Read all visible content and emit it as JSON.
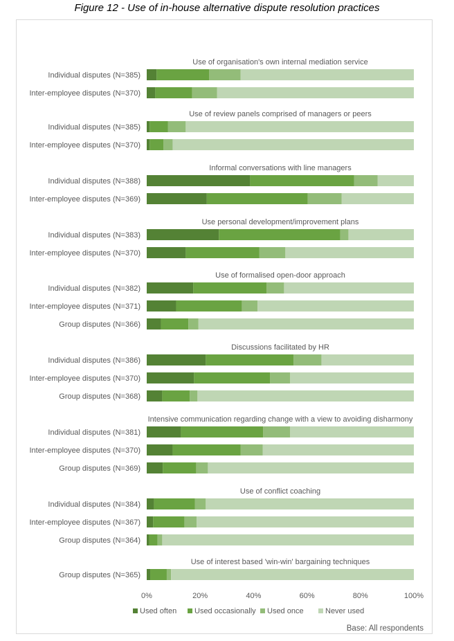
{
  "figure_title": "Figure 12 - Use of in-house alternative dispute resolution practices",
  "base_note": "Base: All respondents",
  "chart_data": {
    "type": "bar",
    "orientation": "horizontal",
    "stacked": "percent",
    "title": "Figure 12 - Use of in-house alternative dispute resolution practices",
    "xlabel": "",
    "ylabel": "",
    "xlim": [
      0,
      100
    ],
    "x_ticks": [
      "0%",
      "20%",
      "40%",
      "60%",
      "80%",
      "100%"
    ],
    "grid": false,
    "legend_position": "bottom",
    "legend": [
      {
        "name": "Used often",
        "color": "#548235"
      },
      {
        "name": "Used occasionally",
        "color": "#6aa342"
      },
      {
        "name": "Used once",
        "color": "#93bc79"
      },
      {
        "name": "Never used",
        "color": "#bfd6b4"
      }
    ],
    "groups": [
      {
        "title": "Use of organisation's own internal mediation service",
        "rows": [
          {
            "label": "Individual disputes (N=385)",
            "values": [
              3.7,
              19.7,
              11.7,
              64.9
            ]
          },
          {
            "label": "Inter-employee disputes (N=370)",
            "values": [
              3.2,
              13.8,
              9.3,
              73.7
            ]
          }
        ]
      },
      {
        "title": "Use of review panels comprised of managers or peers",
        "rows": [
          {
            "label": "Individual disputes (N=385)",
            "values": [
              1.1,
              6.8,
              6.7,
              85.4
            ]
          },
          {
            "label": "Inter-employee disputes (N=370)",
            "values": [
              1.1,
              5.2,
              3.4,
              90.3
            ]
          }
        ]
      },
      {
        "title": "Informal conversations with line managers",
        "rows": [
          {
            "label": "Individual disputes (N=388)",
            "values": [
              38.7,
              38.9,
              8.8,
              13.6
            ]
          },
          {
            "label": "Inter-employee disputes (N=369)",
            "values": [
              22.5,
              37.8,
              12.7,
              27.0
            ]
          }
        ]
      },
      {
        "title": "Use personal development/improvement plans",
        "rows": [
          {
            "label": "Individual disputes (N=383)",
            "values": [
              27.0,
              45.4,
              3.1,
              24.5
            ]
          },
          {
            "label": "Inter-employee disputes (N=370)",
            "values": [
              14.6,
              27.5,
              9.8,
              48.1
            ]
          }
        ]
      },
      {
        "title": "Use of formalised open-door approach",
        "rows": [
          {
            "label": "Individual disputes (N=382)",
            "values": [
              17.4,
              27.5,
              6.5,
              48.6
            ]
          },
          {
            "label": "Inter-employee disputes (N=371)",
            "values": [
              11.0,
              24.6,
              5.9,
              58.5
            ]
          },
          {
            "label": "Group disputes (N=366)",
            "values": [
              5.3,
              10.3,
              3.7,
              80.7
            ]
          }
        ]
      },
      {
        "title": "Discussions facilitated by HR",
        "rows": [
          {
            "label": "Individual disputes (N=386)",
            "values": [
              22.1,
              32.9,
              10.4,
              34.6
            ]
          },
          {
            "label": "Inter-employee disputes (N=370)",
            "values": [
              17.7,
              28.5,
              7.5,
              46.3
            ]
          },
          {
            "label": "Group disputes (N=368)",
            "values": [
              5.8,
              10.3,
              2.9,
              81.0
            ]
          }
        ]
      },
      {
        "title": "Intensive communication regarding change with a view to avoiding disharmony",
        "rows": [
          {
            "label": "Individual disputes (N=381)",
            "values": [
              12.8,
              30.8,
              10.1,
              46.3
            ]
          },
          {
            "label": "Inter-employee disputes (N=370)",
            "values": [
              9.7,
              25.4,
              8.3,
              56.6
            ]
          },
          {
            "label": "Group disputes (N=369)",
            "values": [
              6.0,
              12.5,
              4.4,
              77.1
            ]
          }
        ]
      },
      {
        "title": "Use of conflict coaching",
        "rows": [
          {
            "label": "Individual disputes (N=384)",
            "values": [
              2.7,
              15.3,
              4.1,
              77.9
            ]
          },
          {
            "label": "Inter-employee disputes (N=367)",
            "values": [
              2.4,
              11.7,
              4.6,
              81.3
            ]
          },
          {
            "label": "Group disputes (N=364)",
            "values": [
              0.9,
              3.1,
              1.8,
              94.2
            ]
          }
        ]
      },
      {
        "title": "Use of interest based 'win-win' bargaining techniques",
        "rows": [
          {
            "label": "Group disputes (N=365)",
            "values": [
              1.3,
              6.2,
              1.6,
              90.9
            ]
          }
        ]
      }
    ]
  }
}
